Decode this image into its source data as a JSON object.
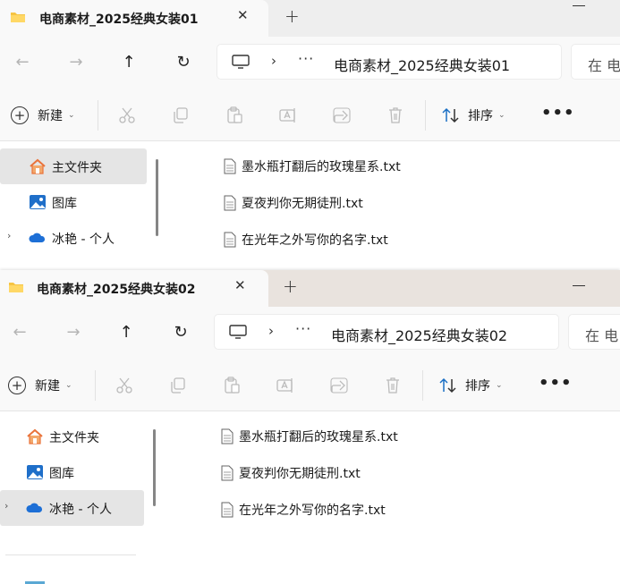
{
  "windows": [
    {
      "tab_title": "电商素材_2025经典女装01",
      "address_path": "电商素材_2025经典女装01",
      "search_placeholder": "在 电",
      "toolbar": {
        "new_label": "新建",
        "sort_label": "排序"
      },
      "sidebar": [
        {
          "label": "主文件夹",
          "icon": "home-icon",
          "active": true,
          "expandable": false
        },
        {
          "label": "图库",
          "icon": "gallery-icon",
          "active": false,
          "expandable": false
        },
        {
          "label": "冰艳 - 个人",
          "icon": "onedrive-cloud-icon",
          "active": false,
          "expandable": true
        }
      ],
      "files": [
        {
          "name": "墨水瓶打翻后的玫瑰星系.txt"
        },
        {
          "name": "夏夜判你无期徒刑.txt"
        },
        {
          "name": "在光年之外写你的名字.txt"
        }
      ]
    },
    {
      "tab_title": "电商素材_2025经典女装02",
      "address_path": "电商素材_2025经典女装02",
      "search_placeholder": "在 电",
      "toolbar": {
        "new_label": "新建",
        "sort_label": "排序"
      },
      "sidebar": [
        {
          "label": "主文件夹",
          "icon": "home-icon",
          "active": false,
          "expandable": false
        },
        {
          "label": "图库",
          "icon": "gallery-icon",
          "active": false,
          "expandable": false
        },
        {
          "label": "冰艳 - 个人",
          "icon": "onedrive-cloud-icon",
          "active": true,
          "expandable": true
        }
      ],
      "files": [
        {
          "name": "墨水瓶打翻后的玫瑰星系.txt"
        },
        {
          "name": "夏夜判你无期徒刑.txt"
        },
        {
          "name": "在光年之外写你的名字.txt"
        }
      ]
    }
  ],
  "colors": {
    "folder_yellow": "#f6c443",
    "selection_gray": "#e5e5e5",
    "onedrive_blue": "#1d6fd6",
    "home_orange": "#e9733a",
    "gallery_blue": "#1f6fc9"
  }
}
